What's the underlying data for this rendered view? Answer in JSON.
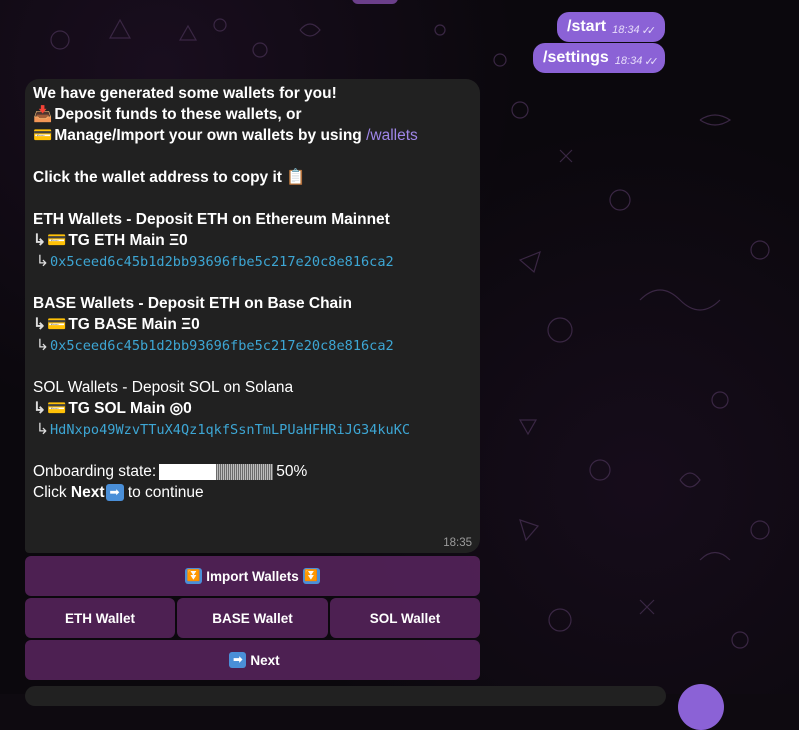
{
  "outgoing": [
    {
      "text": "/start",
      "time": "18:34",
      "ticks": "✓✓"
    },
    {
      "text": "/settings",
      "time": "18:34",
      "ticks": "✓✓"
    }
  ],
  "message": {
    "line1": "We have generated some wallets for you!",
    "deposit_emoji": "📥",
    "line2": "Deposit funds to these wallets, or",
    "card_emoji": "💳",
    "line3_prefix": "Manage/Import your own wallets by using",
    "line3_link": "/wallets",
    "copy_text": "Click the wallet address to copy it",
    "clipboard_emoji": "📋",
    "hook": "↳",
    "eth_header": "ETH Wallets - Deposit ETH on Ethereum Mainnet",
    "eth_wallet": "TG ETH Main Ξ0",
    "eth_address": "0x5ceed6c45b1d2bb93696fbe5c217e20c8e816ca2",
    "base_header": "BASE Wallets - Deposit ETH on Base Chain",
    "base_wallet": "TG BASE Main Ξ0",
    "base_address": "0x5ceed6c45b1d2bb93696fbe5c217e20c8e816ca2",
    "sol_header": "SOL Wallets - Deposit SOL on Solana",
    "sol_wallet": "TG SOL Main ◎0",
    "sol_address": "HdNxpo49WzvTTuX4Qz1qkfSsnTmLPUaHFHRiJG34kuKC",
    "onboarding_label": "Onboarding state:",
    "onboarding_progress": 0.5,
    "onboarding_percent": "50%",
    "click_prefix": "Click",
    "click_next": "Next",
    "next_emoji": "➡",
    "click_suffix": "to continue",
    "time": "18:35"
  },
  "keyboard": {
    "import_emoji": "⏬",
    "import": "Import Wallets",
    "eth": "ETH Wallet",
    "base": "BASE Wallet",
    "sol": "SOL Wallet",
    "next_emoji": "➡",
    "next": "Next"
  },
  "colors": {
    "accent": "#8b62d6",
    "link": "#9f86e8",
    "address": "#3da6d4",
    "bubble": "#212121",
    "keyboard": "#5c2662"
  }
}
